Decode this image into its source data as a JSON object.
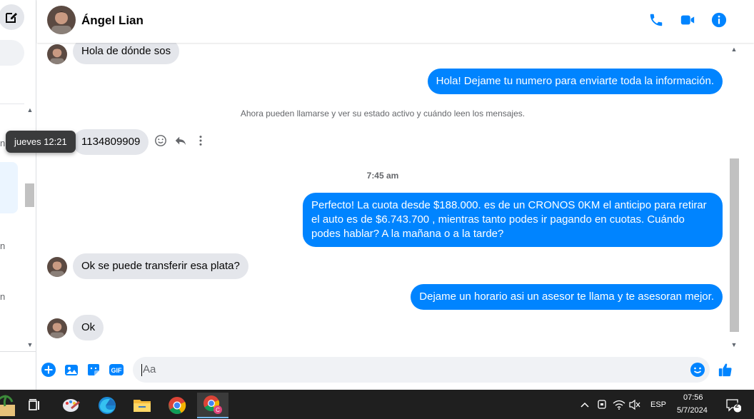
{
  "colors": {
    "accent": "#0084ff",
    "incoming_bubble": "#e4e6eb",
    "taskbar": "#1f1f1f"
  },
  "header": {
    "contact_name": "Ángel Lian",
    "actions": [
      "phone-icon",
      "video-icon",
      "info-icon"
    ]
  },
  "conversation": {
    "msg1": "Hola de dónde sos",
    "msg2": "Hola! Dejame tu numero  para enviarte toda la información.",
    "system_notice": "Ahora pueden llamarse y ver su estado activo y cuándo leen los mensajes.",
    "msg3": "1134809909",
    "tooltip": "jueves 12:21",
    "time_separator": "7:45 am",
    "msg4": "Perfecto! La cuota desde $188.000. es de un CRONOS 0KM el anticipo para retirar el auto es de $6.743.700 , mientras tanto podes ir pagando en cuotas. Cuándo podes hablar? A la mañana o a la tarde?",
    "msg5": "Ok se puede transferir esa plata?",
    "msg6": "Dejame un horario asi un asesor te llama y te asesoran mejor.",
    "msg7": "Ok"
  },
  "sidebar": {
    "fragments": [
      "n",
      "n",
      "n"
    ]
  },
  "composer": {
    "placeholder": "Aa"
  },
  "taskbar": {
    "language": "ESP",
    "time": "07:56",
    "date": "5/7/2024",
    "notification_count": "2"
  }
}
